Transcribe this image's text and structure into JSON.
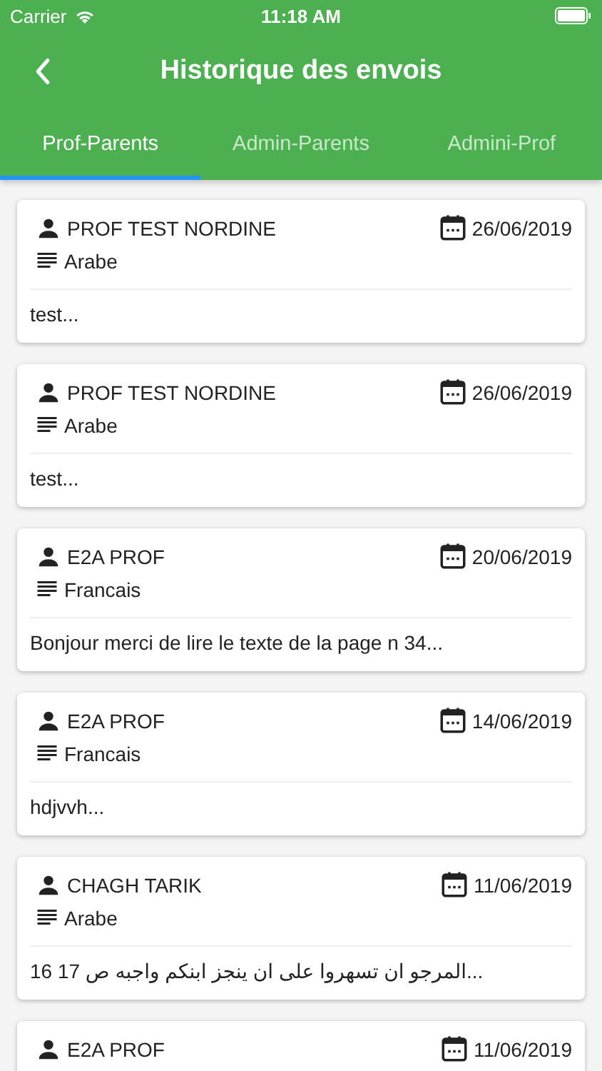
{
  "status_bar": {
    "carrier": "Carrier",
    "time": "11:18 AM"
  },
  "header": {
    "title": "Historique des envois"
  },
  "tabs": [
    {
      "label": "Prof-Parents",
      "selected": true
    },
    {
      "label": "Admin-Parents",
      "selected": false
    },
    {
      "label": "Admini-Prof",
      "selected": false
    }
  ],
  "messages": [
    {
      "author": "PROF TEST NORDINE",
      "date": "26/06/2019",
      "subject": "Arabe",
      "preview": "test..."
    },
    {
      "author": "PROF TEST NORDINE",
      "date": "26/06/2019",
      "subject": "Arabe",
      "preview": "test..."
    },
    {
      "author": "E2A PROF",
      "date": "20/06/2019",
      "subject": "Francais",
      "preview": "Bonjour merci de lire le texte de la page n 34..."
    },
    {
      "author": "E2A PROF",
      "date": "14/06/2019",
      "subject": "Francais",
      "preview": "hdjvvh..."
    },
    {
      "author": "CHAGH TARIK",
      "date": "11/06/2019",
      "subject": "Arabe",
      "preview": "المرجو ان تسهروا على ان ينجز ابنكم واجبه ص 17 16..."
    },
    {
      "author": "E2A PROF",
      "date": "11/06/2019"
    }
  ]
}
